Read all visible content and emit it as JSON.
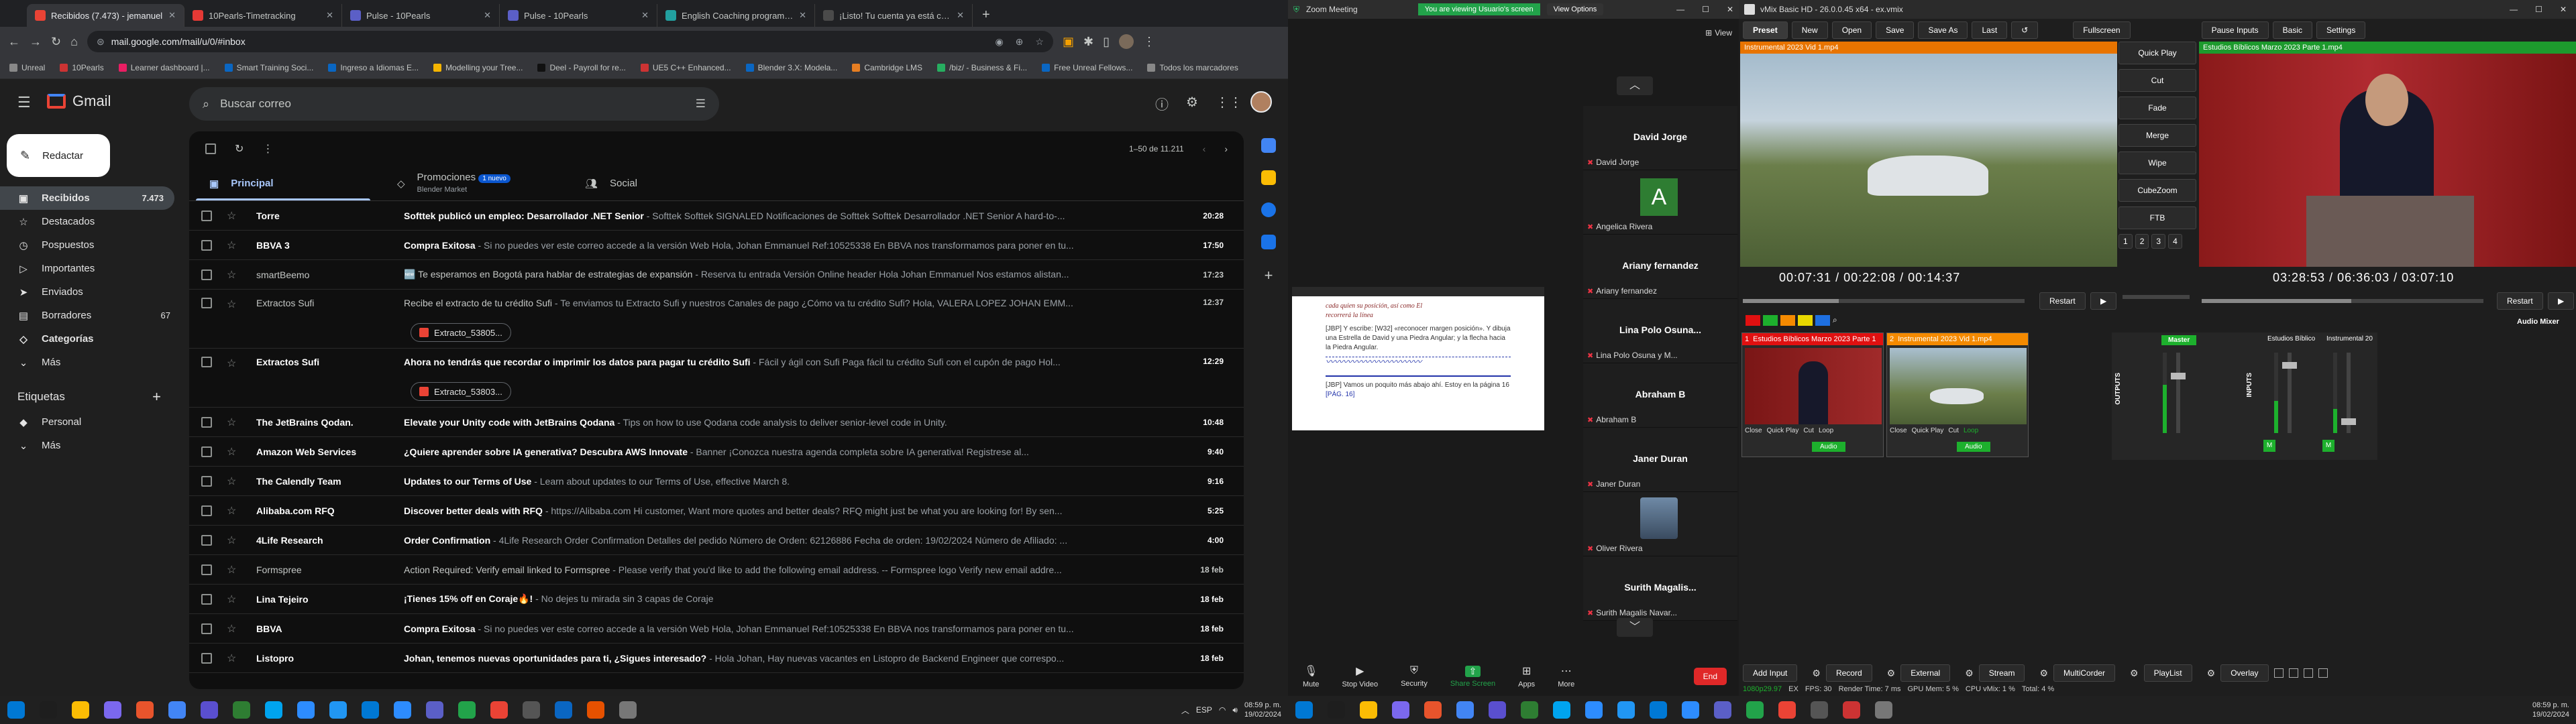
{
  "chrome": {
    "tabs": [
      {
        "title": "Recibidos (7.473) - jemanuel",
        "color": "#ea4335"
      },
      {
        "title": "10Pearls-Timetracking",
        "color": "#e53935"
      },
      {
        "title": "Pulse - 10Pearls",
        "color": "#5b5fc7"
      },
      {
        "title": "Pulse - 10Pearls",
        "color": "#5b5fc7"
      },
      {
        "title": "English Coaching program - H",
        "color": "#22a0a0"
      },
      {
        "title": "¡Listo! Tu cuenta ya está creada",
        "color": "#4a4a4a"
      }
    ],
    "new_tab": "+",
    "url": "mail.google.com/mail/u/0/#inbox",
    "bookmarks": [
      {
        "label": "Unreal",
        "color": "#888"
      },
      {
        "label": "10Pearls",
        "color": "#c33"
      },
      {
        "label": "Learner dashboard |...",
        "color": "#e91e63"
      },
      {
        "label": "Smart Training Soci...",
        "color": "#0a66c2"
      },
      {
        "label": "Ingreso a Idiomas E...",
        "color": "#0a66c2"
      },
      {
        "label": "Modelling your Tree...",
        "color": "#f4b400"
      },
      {
        "label": "Deel - Payroll for re...",
        "color": "#111"
      },
      {
        "label": "UE5 C++ Enhanced...",
        "color": "#c33"
      },
      {
        "label": "Blender 3.X: Modela...",
        "color": "#0a66c2"
      },
      {
        "label": "Cambridge LMS",
        "color": "#e67e22"
      },
      {
        "label": "/biz/ - Business & Fi...",
        "color": "#27ae60"
      },
      {
        "label": "Free Unreal Fellows...",
        "color": "#0a66c2"
      },
      {
        "label": "Todos los marcadores",
        "color": "#888"
      }
    ]
  },
  "gmail": {
    "brand": "Gmail",
    "search_placeholder": "Buscar correo",
    "compose": "Redactar",
    "nav": [
      {
        "label": "Recibidos",
        "count": "7.473",
        "icon": "inbox-icon",
        "selected": true
      },
      {
        "label": "Destacados",
        "count": "",
        "icon": "star-icon"
      },
      {
        "label": "Pospuestos",
        "count": "",
        "icon": "clock-icon"
      },
      {
        "label": "Importantes",
        "count": "",
        "icon": "important-icon"
      },
      {
        "label": "Enviados",
        "count": "",
        "icon": "send-icon"
      },
      {
        "label": "Borradores",
        "count": "67",
        "icon": "draft-icon"
      },
      {
        "label": "Categorías",
        "count": "",
        "icon": "label-icon",
        "bold": true
      },
      {
        "label": "Más",
        "count": "",
        "icon": "chevron-down-icon"
      }
    ],
    "labels_header": "Etiquetas",
    "labels": [
      {
        "label": "Personal"
      },
      {
        "label": "Más"
      }
    ],
    "pagination": "1–50 de 11.211",
    "tabs": [
      {
        "label": "Principal",
        "sub": "",
        "badge": ""
      },
      {
        "label": "Promociones",
        "sub": "Blender Market",
        "badge": "1 nuevo"
      },
      {
        "label": "Social",
        "sub": "",
        "badge": ""
      }
    ],
    "emails": [
      {
        "from": "Torre",
        "subject": "Softtek publicó un empleo: Desarrollador .NET Senior",
        "snippet": " - Softtek Softtek SIGNALED Notificaciones de Softtek Softtek Desarrollador .NET Senior A hard-to-...",
        "date": "20:28",
        "unread": true
      },
      {
        "from": "BBVA 3",
        "subject": "Compra Exitosa",
        "snippet": " - Si no puedes ver este correo accede a la versión Web Hola, Johan Emmanuel Ref:10525338 En BBVA nos transformamos para poner en tu...",
        "date": "17:50",
        "unread": true
      },
      {
        "from": "smartBeemo",
        "subject": "🆕 Te esperamos en Bogotá para hablar de estrategias de expansión",
        "snippet": " - Reserva tu entrada Versión Online header Hola Johan Emmanuel Nos estamos alistan...",
        "date": "17:23",
        "unread": false
      },
      {
        "from": "Extractos Sufi",
        "subject": "Recibe el extracto de tu crédito Sufi",
        "snippet": " - Te enviamos tu Extracto Sufi y nuestros Canales de pago ¿Cómo va tu crédito Sufi? Hola, VALERA LOPEZ JOHAN EMM...",
        "date": "12:37",
        "unread": false,
        "attachment": "Extracto_53805..."
      },
      {
        "from": "Extractos Sufi",
        "subject": "Ahora no tendrás que recordar o imprimir los datos para pagar tu crédito Sufi",
        "snippet": " - Fácil y ágil con Sufi Paga fácil tu crédito Sufi con el cupón de pago Hol...",
        "date": "12:29",
        "unread": true,
        "attachment": "Extracto_53803..."
      },
      {
        "from": "The JetBrains Qodan.",
        "subject": "Elevate your Unity code with JetBrains Qodana",
        "snippet": " - Tips on how to use Qodana code analysis to deliver senior-level code in Unity.",
        "date": "10:48",
        "unread": true
      },
      {
        "from": "Amazon Web Services",
        "subject": "¿Quiere aprender sobre IA generativa? Descubra AWS Innovate",
        "snippet": " - Banner ¡Conozca nuestra agenda completa sobre IA generativa! Registrese al...",
        "date": "9:40",
        "unread": true
      },
      {
        "from": "The Calendly Team",
        "subject": "Updates to our Terms of Use",
        "snippet": " - Learn about updates to our Terms of Use, effective March 8.",
        "date": "9:16",
        "unread": true
      },
      {
        "from": "Alibaba.com RFQ",
        "subject": "Discover better deals with RFQ",
        "snippet": " - https://Alibaba.com Hi customer, Want more quotes and better deals? RFQ might just be what you are looking for! By sen...",
        "date": "5:25",
        "unread": true
      },
      {
        "from": "4Life Research",
        "subject": "Order Confirmation",
        "snippet": " - 4Life Research Order Confirmation Detalles del pedido Número de Orden: 62126886 Fecha de orden: 19/02/2024 Número de Afiliado: ...",
        "date": "4:00",
        "unread": true
      },
      {
        "from": "Formspree",
        "subject": "Action Required: Verify email linked to Formspree",
        "snippet": " - Please verify that you'd like to add the following email address. -- Formspree logo Verify new email addre...",
        "date": "18 feb",
        "unread": false
      },
      {
        "from": "Lina Tejeiro",
        "subject": "¡Tienes 15% off en Coraje🔥!",
        "snippet": " - No dejes tu mirada sin 3 capas de Coraje",
        "date": "18 feb",
        "unread": true
      },
      {
        "from": "BBVA",
        "subject": "Compra Exitosa",
        "snippet": " - Si no puedes ver este correo accede a la versión Web Hola, Johan Emmanuel Ref:10525338 En BBVA nos transformamos para poner en tu...",
        "date": "18 feb",
        "unread": true
      },
      {
        "from": "Listopro",
        "subject": "Johan, tenemos nuevas oportunidades para ti, ¿Sigues interesado?",
        "snippet": " - Hola Johan, Hay nuevas vacantes en Listopro de Backend Engineer que correspo...",
        "date": "18 feb",
        "unread": true
      }
    ]
  },
  "zoom": {
    "title": "Zoom Meeting",
    "banner": "You are viewing Usuario's screen",
    "view_options": "View Options",
    "view": "View",
    "shared_doc": {
      "line1": "cada quien su posición, así como El",
      "line2": "recorrerá la línea",
      "line3": "[JBP] Y escribe: [W32] «reconocer margen posición». Y dibuja una Estrella de David y una Piedra Angular; y la flecha hacia la Piedra Angular.",
      "line4": "[JBP] Vamos un poquito más abajo ahí. Estoy en la página 16",
      "line5": "[PÁG. 16]"
    },
    "participants": [
      {
        "tile_name": "David Jorge",
        "label": "David Jorge",
        "type": "name"
      },
      {
        "tile_name": "A",
        "label": "Angelica Rivera",
        "type": "avatar"
      },
      {
        "tile_name": "Ariany fernandez",
        "label": "Ariany fernandez",
        "type": "name"
      },
      {
        "tile_name": "Lina Polo Osuna...",
        "label": "Lina Polo Osuna y M...",
        "type": "name"
      },
      {
        "tile_name": "Abraham B",
        "label": "Abraham B",
        "type": "name"
      },
      {
        "tile_name": "Janer Duran",
        "label": "Janer Duran",
        "type": "name"
      },
      {
        "tile_name": "",
        "label": "Oliver Rivera",
        "type": "photo"
      },
      {
        "tile_name": "Surith Magalis...",
        "label": "Surith Magalis Navar...",
        "type": "name"
      }
    ],
    "bottom": [
      {
        "label": "Mute",
        "icon": "mic-icon"
      },
      {
        "label": "Stop Video",
        "icon": "video-icon"
      },
      {
        "label": "Security",
        "icon": "shield-icon"
      },
      {
        "label": "Share Screen",
        "icon": "share-screen-icon"
      },
      {
        "label": "Apps",
        "icon": "apps-icon"
      },
      {
        "label": "More",
        "icon": "more-icon"
      }
    ],
    "end": "End"
  },
  "vmix": {
    "title": "vMix Basic HD - 26.0.0.45 x64 - ex.vmix",
    "top_buttons": [
      "Preset",
      "New",
      "Open",
      "Save",
      "Save As",
      "Last"
    ],
    "right_buttons": [
      "Fullscreen",
      "Pause Inputs",
      "Basic",
      "Settings"
    ],
    "preview_title": "Instrumental 2023 Vid 1.mp4",
    "output_title": "Estudios Bíblicos Marzo 2023 Parte 1.mp4",
    "preview_time": "00:07:31  /  00:22:08  /  00:14:37",
    "output_time": "03:28:53  /  06:36:03  /  03:07:10",
    "transitions": [
      "Quick Play",
      "Cut",
      "Fade",
      "Merge",
      "Wipe",
      "CubeZoom",
      "FTB"
    ],
    "trans_nums": [
      "1",
      "2",
      "3",
      "4"
    ],
    "restart": "Restart",
    "audio_mixer": "Audio Mixer",
    "inputs": [
      {
        "num": "1",
        "title": "Estudios Bíblicos Marzo 2023 Parte 1",
        "color": "#e01010"
      },
      {
        "num": "2",
        "title": "Instrumental 2023 Vid 1.mp4",
        "color": "#f58a00"
      }
    ],
    "input_controls": [
      "Close",
      "Quick Play",
      "Cut",
      "Loop"
    ],
    "input_audio": "Audio",
    "mixer": {
      "master": "Master",
      "outputs": "OUTPUTS",
      "inputs_label": "INPUTS",
      "ch1": "Estudios Bíblico",
      "ch2": "Instrumental 20"
    },
    "bottom": [
      "Add Input",
      "Record",
      "External",
      "Stream",
      "MultiCorder",
      "PlayList",
      "Overlay"
    ],
    "status": {
      "res": "1080p29.97",
      "ex": "EX",
      "fps": "FPS: 30",
      "render": "Render Time: 7 ms",
      "gpu": "GPU Mem: 5 %",
      "cpu": "CPU vMix: 1 %",
      "total": "Total: 4 %"
    }
  },
  "taskbar": {
    "lang": "ESP",
    "time": "08:59 p. m.",
    "date": "19/02/2024"
  }
}
